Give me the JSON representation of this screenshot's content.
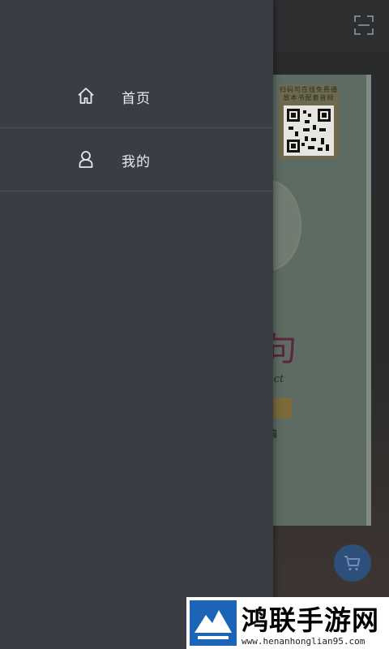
{
  "drawer": {
    "items": [
      {
        "label": "首页",
        "icon": "home-icon"
      },
      {
        "label": "我的",
        "icon": "user-icon"
      }
    ]
  },
  "background": {
    "scan_icon": "scan-icon",
    "cart_icon": "cart-icon",
    "book": {
      "qr_caption": "扫码可在线免费播放本书配套音频",
      "title_fragment": "句",
      "subtitle_fragment": "ect",
      "author_fragment": "编"
    }
  },
  "watermark": {
    "title": "鸿联手游网",
    "url": "www.henanhonglian95.com"
  },
  "colors": {
    "drawer_bg": "#3a3e44",
    "cart_accent": "#2e4f7a"
  }
}
